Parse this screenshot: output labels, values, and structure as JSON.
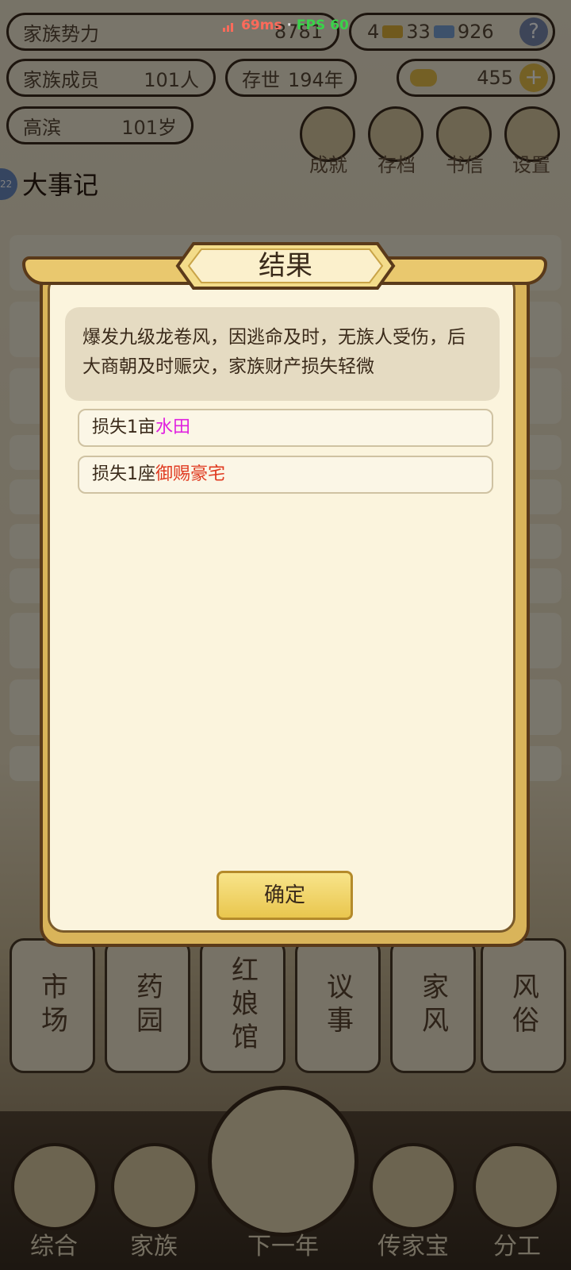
{
  "status": {
    "ping": "69ms",
    "separator": "·",
    "fps": "FPS 60"
  },
  "header": {
    "clan_power_label": "家族势力",
    "clan_power_value": "8781",
    "gold": "4",
    "silver": "33",
    "ticket": "926",
    "help": "?",
    "members_label": "家族成员",
    "members_value": "101人",
    "survival_label": "存世",
    "survival_value": "194年",
    "ingots": "455",
    "plus": "+",
    "elder_name": "高滨",
    "elder_age": "101岁"
  },
  "top_buttons": [
    {
      "label": "成就",
      "icon": "achievement-icon"
    },
    {
      "label": "存档",
      "icon": "archive-icon"
    },
    {
      "label": "书信",
      "icon": "letter-icon"
    },
    {
      "label": "设置",
      "icon": "settings-icon"
    }
  ],
  "chronicle": {
    "badge": "22",
    "title": "大事记"
  },
  "facilities": [
    "市场",
    "药园",
    "红娘馆",
    "议事",
    "家风",
    "风俗"
  ],
  "bottom_nav": [
    "综合",
    "家族",
    "下一年",
    "传家宝",
    "分工"
  ],
  "dialog": {
    "title": "结果",
    "message": "爆发九级龙卷风，因逃命及时，无族人受伤，后大商朝及时赈灾，家族财产损失轻微",
    "items": [
      {
        "prefix": "损失1亩",
        "name": "水田",
        "color": "#e020e0"
      },
      {
        "prefix": "损失1座",
        "name": "御赐豪宅",
        "color": "#e03a20"
      }
    ],
    "confirm_label": "确定"
  },
  "colors": {
    "ping": "#ff6a5a",
    "fps": "#3ad24a"
  }
}
